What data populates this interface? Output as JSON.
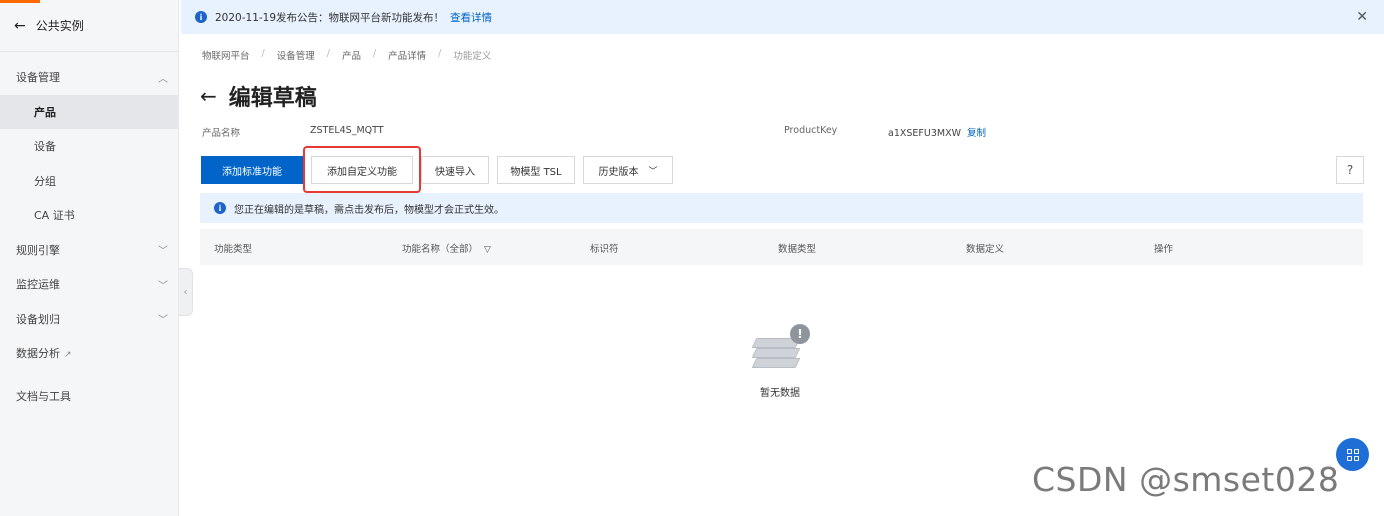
{
  "sidebar": {
    "back_label": "公共实例",
    "items": [
      {
        "label": "设备管理",
        "type": "group",
        "expanded": true
      },
      {
        "label": "产品",
        "type": "sub",
        "active": true
      },
      {
        "label": "设备",
        "type": "sub"
      },
      {
        "label": "分组",
        "type": "sub"
      },
      {
        "label": "CA 证书",
        "type": "sub"
      },
      {
        "label": "规则引擎",
        "type": "group",
        "expanded": false
      },
      {
        "label": "监控运维",
        "type": "group",
        "expanded": false
      },
      {
        "label": "设备划归",
        "type": "group",
        "expanded": false
      },
      {
        "label": "数据分析",
        "type": "external"
      },
      {
        "label": "文档与工具",
        "type": "plain"
      }
    ]
  },
  "notice": {
    "text": "2020-11-19发布公告：物联网平台新功能发布！",
    "link": "查看详情"
  },
  "breadcrumb": [
    "物联网平台",
    "设备管理",
    "产品",
    "产品详情",
    "功能定义"
  ],
  "page": {
    "title": "编辑草稿"
  },
  "product_info": {
    "name_label": "产品名称",
    "name_value": "ZSTEL4S_MQTT",
    "key_label": "ProductKey",
    "key_value": "a1XSEFU3MXW",
    "copy_label": "复制"
  },
  "toolbar": {
    "add_standard": "添加标准功能",
    "add_custom": "添加自定义功能",
    "quick_import": "快速导入",
    "tsl_model": "物模型 TSL",
    "history_version": "历史版本",
    "help": "?"
  },
  "tip": {
    "text": "您正在编辑的是草稿，需点击发布后，物模型才会正式生效。"
  },
  "table": {
    "columns": [
      "功能类型",
      "功能名称（全部）",
      "标识符",
      "数据类型",
      "数据定义",
      "操作"
    ]
  },
  "empty": {
    "text": "暂无数据"
  },
  "watermark": "CSDN @smset028",
  "colors": {
    "primary": "#0064c8",
    "highlight_border": "#e53935",
    "notice_bg": "#e8f2fe",
    "brand_orange": "#ff6a00"
  }
}
